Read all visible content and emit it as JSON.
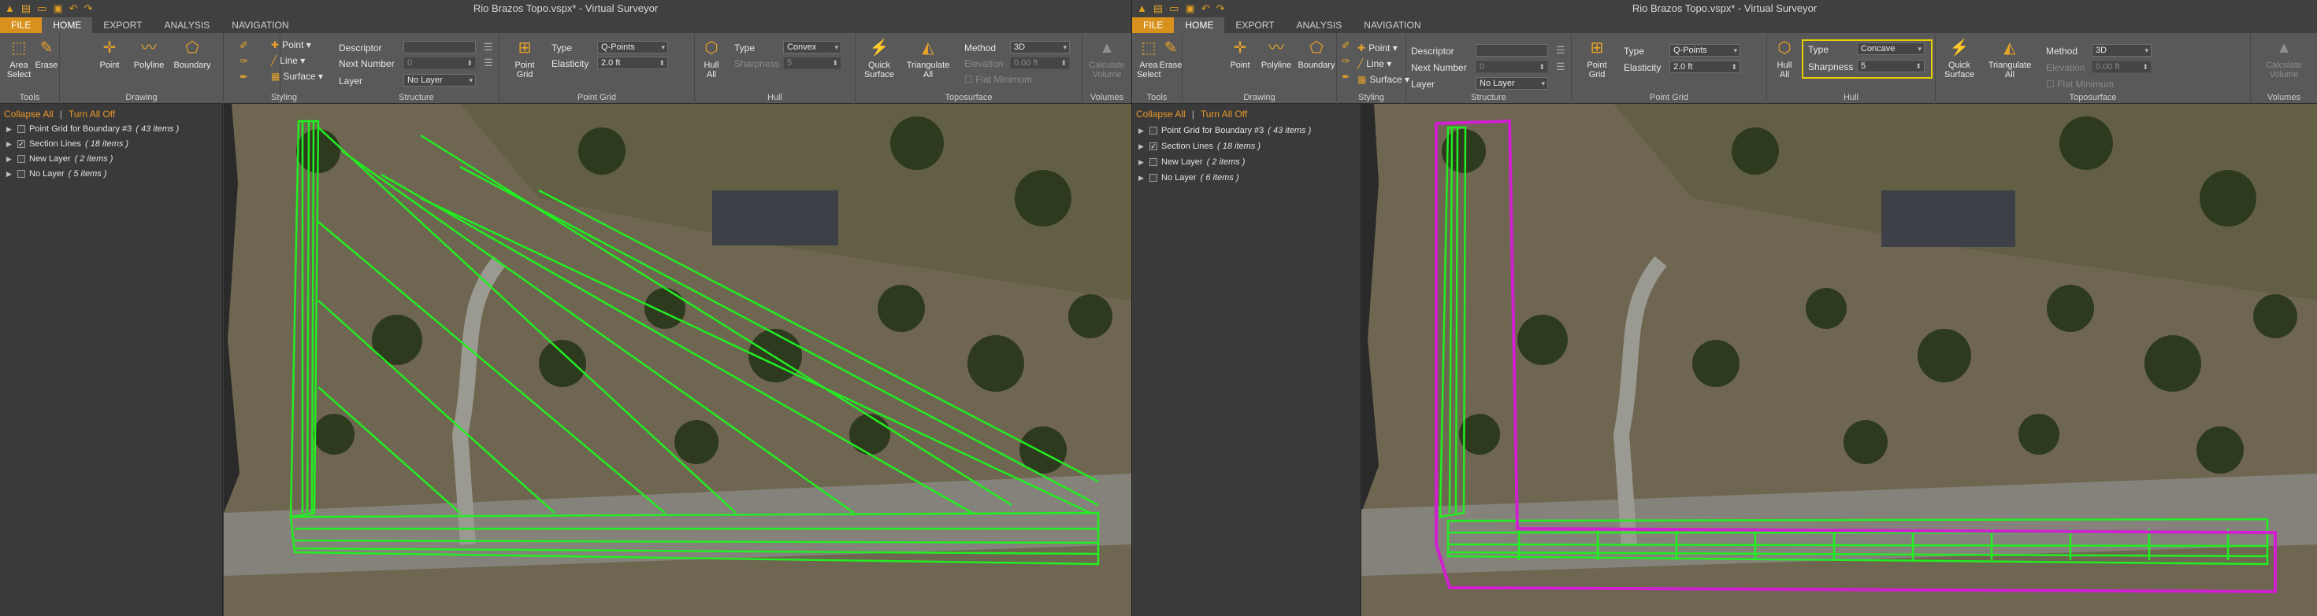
{
  "left": {
    "quick_access": [
      "▲",
      "▤",
      "▭",
      "▣",
      "↶",
      "↷"
    ],
    "title": "Rio Brazos Topo.vspx* - Virtual Surveyor",
    "tabs": {
      "file": "FILE",
      "home": "HOME",
      "export": "EXPORT",
      "analysis": "ANALYSIS",
      "navigation": "NAVIGATION"
    },
    "ribbon": {
      "tools": {
        "label": "Tools",
        "area_select": "Area\nSelect",
        "erase": "Erase"
      },
      "drawing": {
        "label": "Drawing",
        "point": "Point",
        "polyline": "Polyline",
        "boundary": "Boundary"
      },
      "styling": {
        "label": "Styling",
        "point": "Point",
        "line": "Line",
        "surface": "Surface"
      },
      "structure": {
        "label": "Structure",
        "descriptor": "Descriptor",
        "next_number": "Next Number",
        "next_number_value": "0",
        "layer": "Layer",
        "layer_value": "No Layer"
      },
      "point_grid": {
        "label": "Point Grid",
        "button": "Point\nGrid",
        "type": "Type",
        "type_value": "Q-Points",
        "elasticity": "Elasticity",
        "elasticity_value": "2.0 ft"
      },
      "hull": {
        "label": "Hull",
        "button": "Hull\nAll",
        "type": "Type",
        "type_value": "Convex",
        "sharpness": "Sharpness",
        "sharpness_value": "5"
      },
      "toposurface": {
        "label": "Toposurface",
        "quick_surface": "Quick\nSurface",
        "triangulate_all": "Triangulate\nAll",
        "method": "Method",
        "method_value": "3D",
        "elevation": "Elevation",
        "elevation_value": "0.00 ft",
        "flat_minimum": "Flat Minimum"
      },
      "volumes": {
        "label": "Volumes",
        "calculate_volume": "Calculate\nVolume"
      }
    },
    "layers": {
      "collapse_all": "Collapse All",
      "separator": "|",
      "turn_all_off": "Turn All Off",
      "items": [
        {
          "name": "Point Grid for Boundary #3",
          "count": "( 43 items )",
          "checked": ""
        },
        {
          "name": "Section Lines",
          "count": "( 18 items )",
          "checked": "✓"
        },
        {
          "name": "New Layer",
          "count": "( 2 items )",
          "checked": ""
        },
        {
          "name": "No Layer",
          "count": "( 5 items )",
          "checked": ""
        }
      ]
    }
  },
  "right": {
    "quick_access": [
      "▲",
      "▤",
      "▭",
      "▣",
      "↶",
      "↷"
    ],
    "title": "Rio Brazos Topo.vspx* - Virtual Surveyor",
    "tabs": {
      "file": "FILE",
      "home": "HOME",
      "export": "EXPORT",
      "analysis": "ANALYSIS",
      "navigation": "NAVIGATION"
    },
    "ribbon": {
      "tools": {
        "label": "Tools",
        "area_select": "Area\nSelect",
        "erase": "Erase"
      },
      "drawing": {
        "label": "Drawing",
        "point": "Point",
        "polyline": "Polyline",
        "boundary": "Boundary"
      },
      "styling": {
        "label": "Styling",
        "point": "Point",
        "line": "Line",
        "surface": "Surface"
      },
      "structure": {
        "label": "Structure",
        "descriptor": "Descriptor",
        "next_number": "Next Number",
        "next_number_value": "0",
        "layer": "Layer",
        "layer_value": "No Layer"
      },
      "point_grid": {
        "label": "Point Grid",
        "button": "Point\nGrid",
        "type": "Type",
        "type_value": "Q-Points",
        "elasticity": "Elasticity",
        "elasticity_value": "2.0 ft"
      },
      "hull": {
        "label": "Hull",
        "button": "Hull\nAll",
        "type": "Type",
        "type_value": "Concave",
        "sharpness": "Sharpness",
        "sharpness_value": "5"
      },
      "toposurface": {
        "label": "Toposurface",
        "quick_surface": "Quick\nSurface",
        "triangulate_all": "Triangulate\nAll",
        "method": "Method",
        "method_value": "3D",
        "elevation": "Elevation",
        "elevation_value": "0.00 ft",
        "flat_minimum": "Flat Minimum"
      },
      "volumes": {
        "label": "Volumes",
        "calculate_volume": "Calculate\nVolume"
      }
    },
    "layers": {
      "collapse_all": "Collapse All",
      "separator": "|",
      "turn_all_off": "Turn All Off",
      "items": [
        {
          "name": "Point Grid for Boundary #3",
          "count": "( 43 items )",
          "checked": ""
        },
        {
          "name": "Section Lines",
          "count": "( 18 items )",
          "checked": "✓"
        },
        {
          "name": "New Layer",
          "count": "( 2 items )",
          "checked": ""
        },
        {
          "name": "No Layer",
          "count": "( 6 items )",
          "checked": ""
        }
      ]
    }
  },
  "colors": {
    "accent": "#d8911c",
    "icon": "#e6a22a",
    "hull_line": "#d020d0",
    "mesh_line": "#22ee22",
    "highlight": "#e8d000"
  }
}
